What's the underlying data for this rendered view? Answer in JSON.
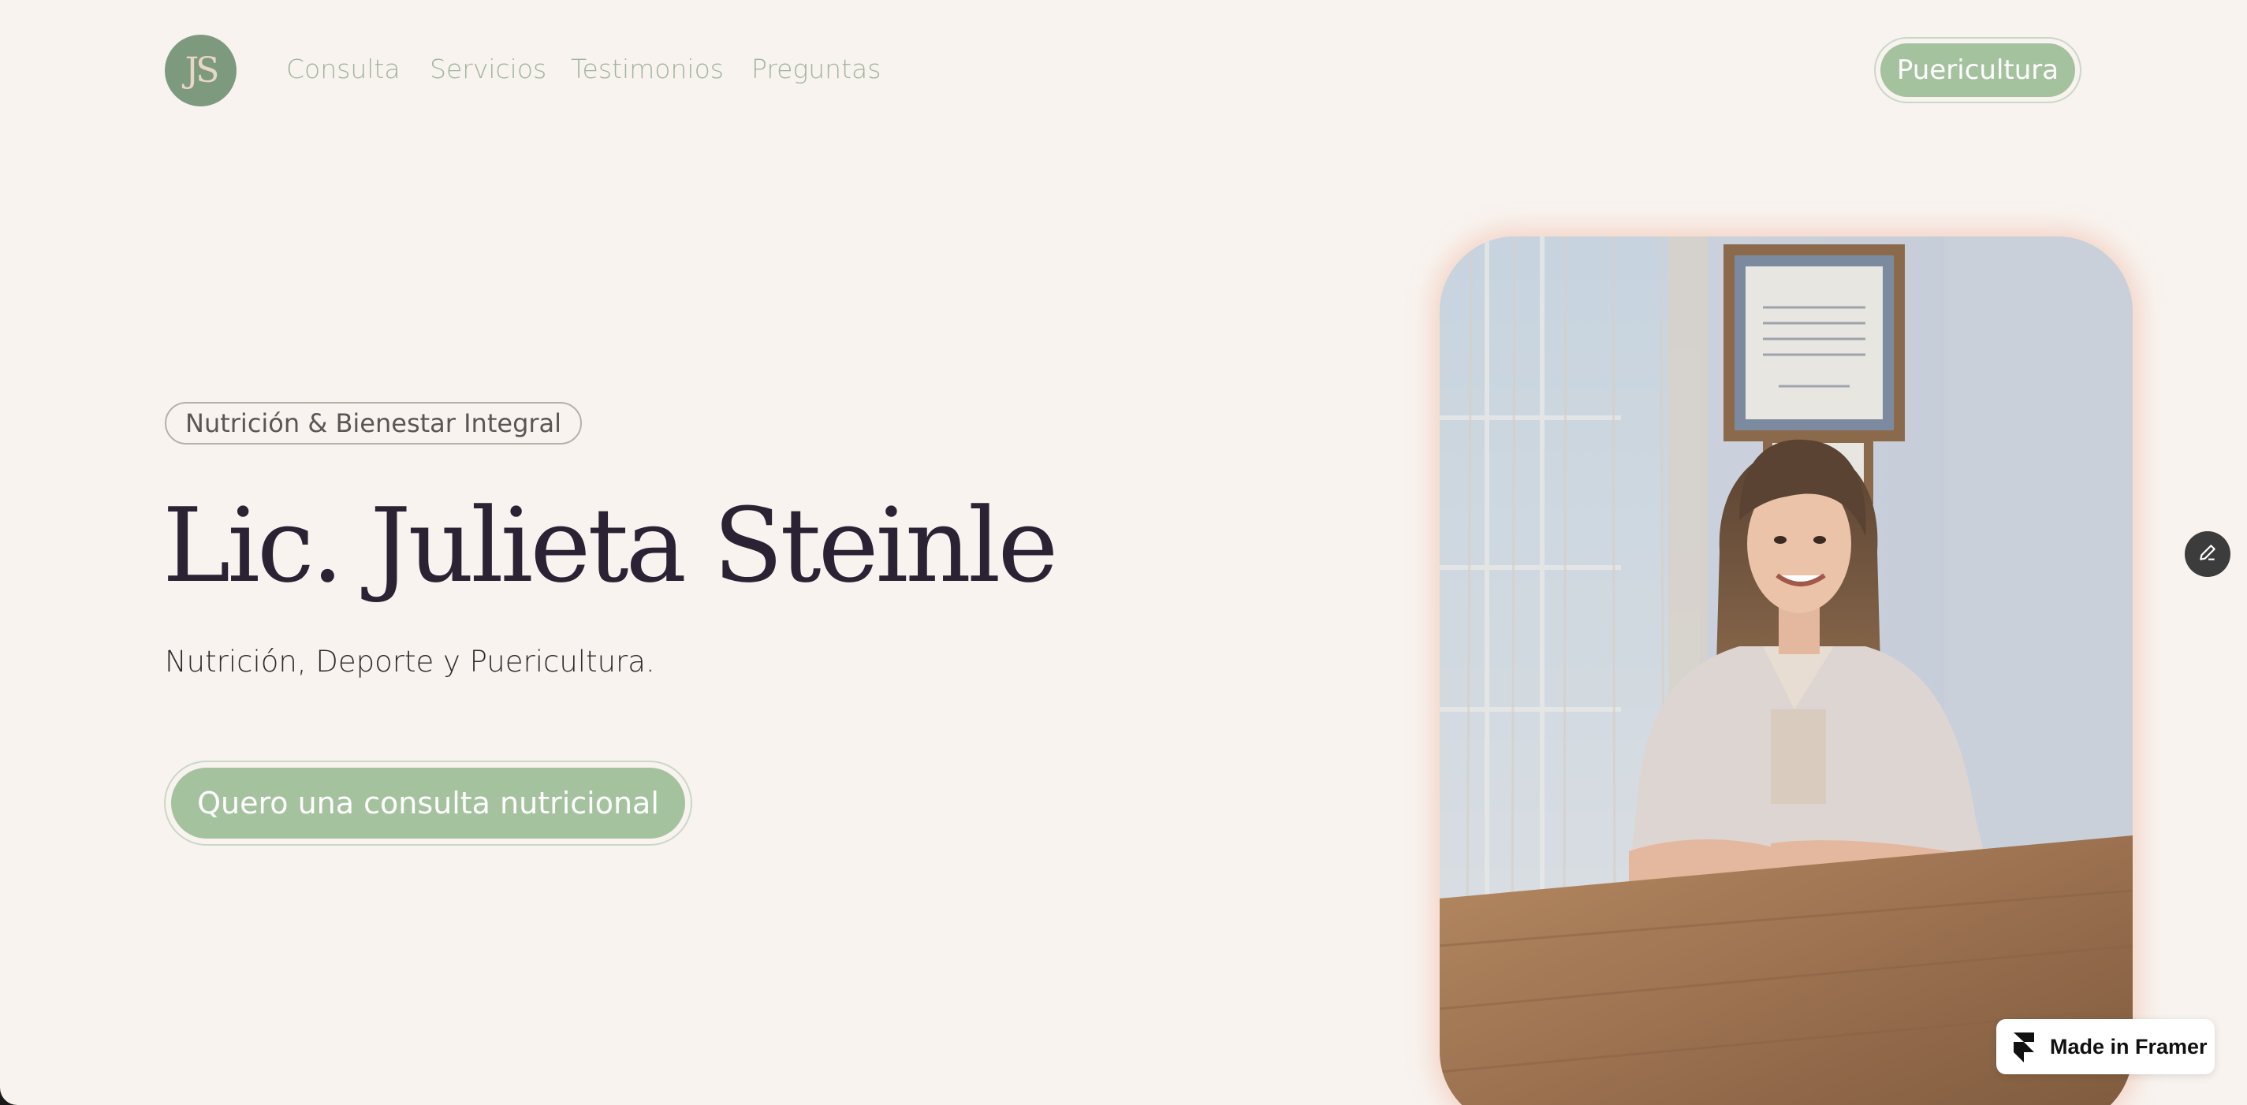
{
  "nav": {
    "logo_text": "JS",
    "links": [
      "Consulta",
      "Servicios",
      "Testimonios",
      "Preguntas"
    ],
    "cta_label": "Puericultura"
  },
  "hero": {
    "tag": "Nutrición & Bienestar Integral",
    "title": "Lic. Julieta Steinle",
    "subtitle": "Nutrición, Deporte y Puericultura.",
    "cta_label": "Quero una consulta nutricional"
  },
  "badge": {
    "label": "Made in Framer"
  },
  "icons": {
    "edit": "pencil-icon",
    "framer": "framer-logo-icon"
  },
  "colors": {
    "background": "#f8f3ef",
    "accent_green": "#a5c29f",
    "logo_green": "#7d9a7f",
    "nav_text": "#9fb59e",
    "heading": "#2b2233"
  }
}
